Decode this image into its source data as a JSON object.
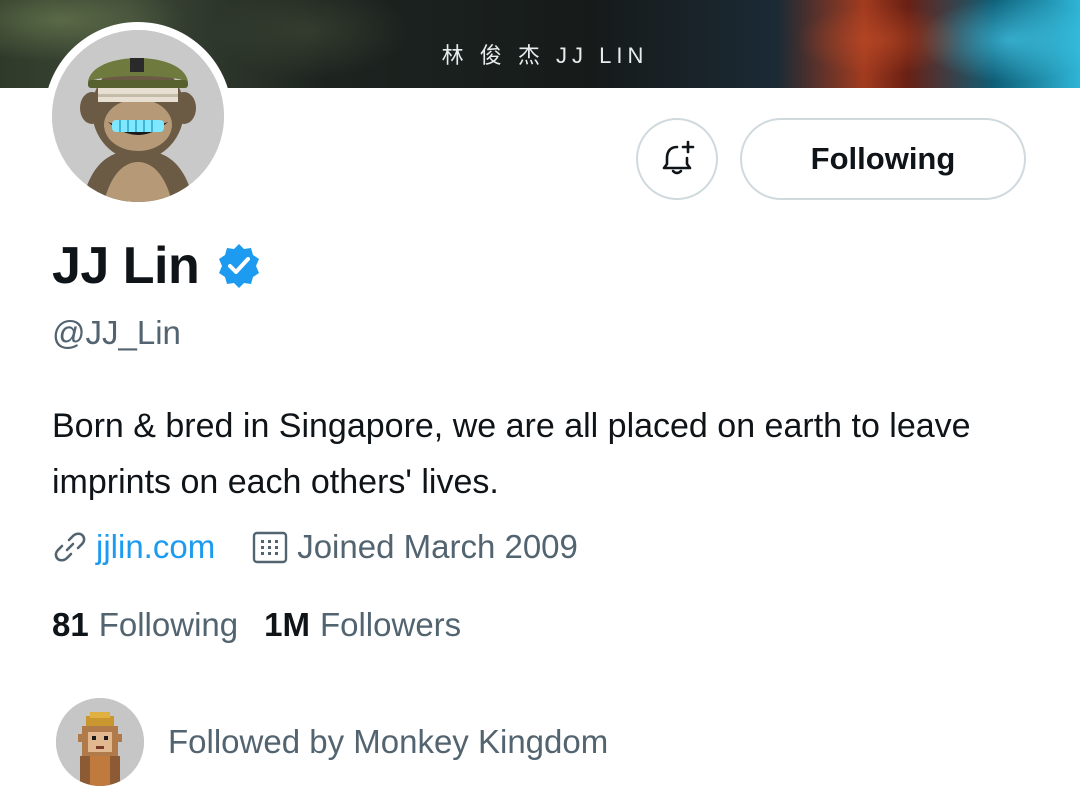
{
  "banner": {
    "title": "林 俊 杰 JJ LIN"
  },
  "actions": {
    "notify_icon": "bell-plus-icon",
    "following_label": "Following"
  },
  "profile": {
    "name": "JJ Lin",
    "verified": true,
    "handle": "@JJ_Lin",
    "bio": "Born & bred in Singapore, we are all placed on earth to leave imprints on each others' lives.",
    "website": "jjlin.com",
    "joined": "Joined March 2009"
  },
  "stats": {
    "following_count": "81",
    "following_label": "Following",
    "followers_count": "1M",
    "followers_label": "Followers"
  },
  "followed_by": {
    "text": "Followed by Monkey Kingdom"
  },
  "colors": {
    "accent": "#1d9bf0",
    "secondary_text": "#536471",
    "primary_text": "#0f1419",
    "border": "#cfd9de"
  }
}
